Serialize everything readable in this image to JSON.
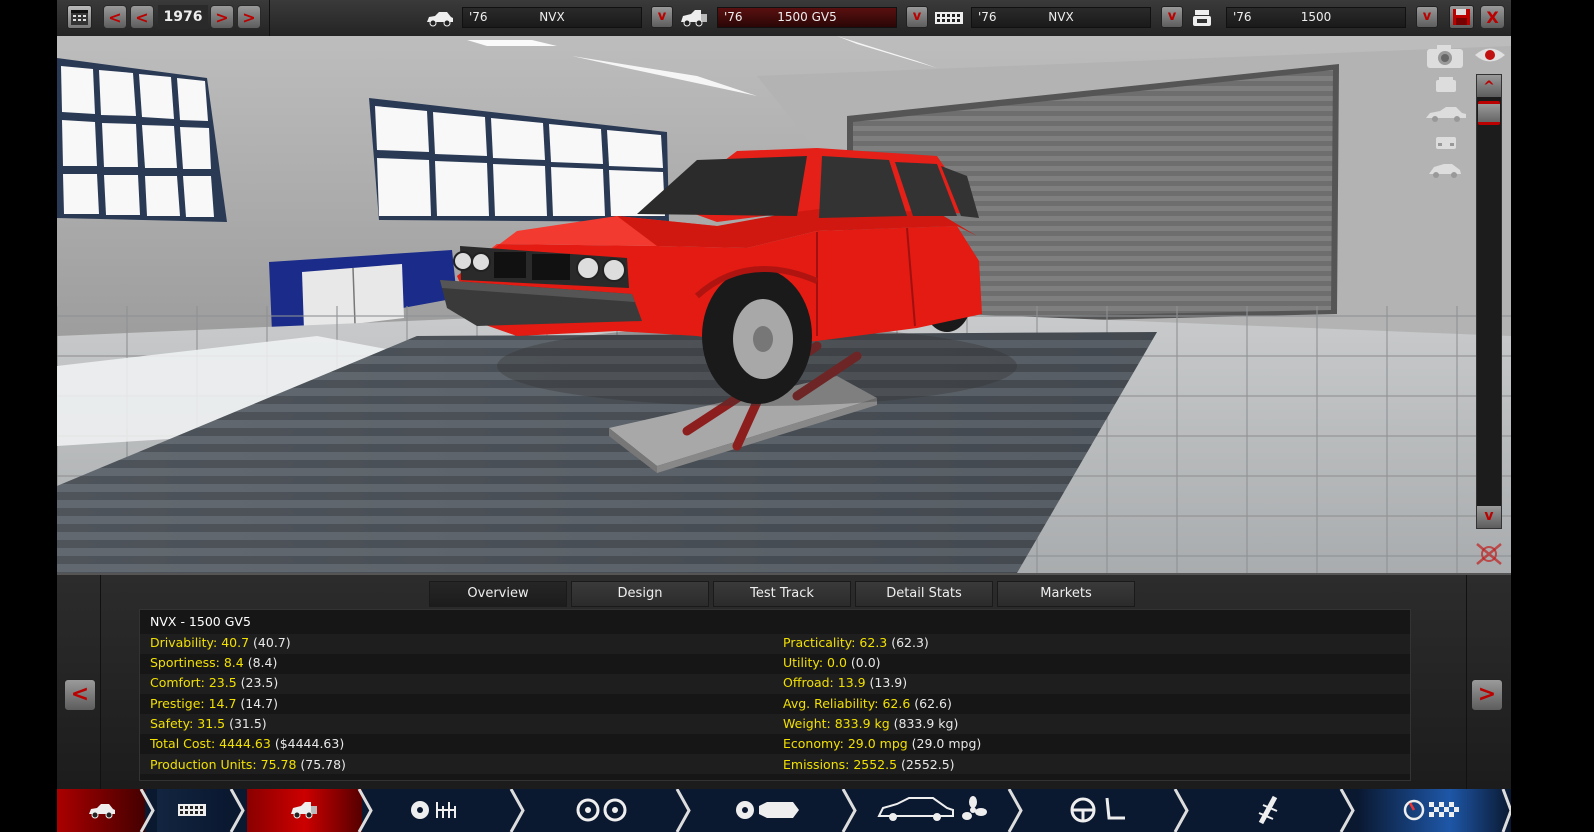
{
  "topbar": {
    "year": "1976",
    "prev_label": "<",
    "next_label": ">",
    "model": {
      "year": "'76",
      "name": "NVX"
    },
    "trim": {
      "year": "'76",
      "name": "1500 GV5"
    },
    "family": {
      "year": "'76",
      "name": "NVX"
    },
    "engine": {
      "year": "'76",
      "name": "1500"
    },
    "dropdown_label": "v",
    "close_label": "X"
  },
  "viewport": {
    "up_label": "^",
    "down_label": "v"
  },
  "tabs": [
    {
      "label": "Overview",
      "active": true
    },
    {
      "label": "Design",
      "active": false
    },
    {
      "label": "Test Track",
      "active": false
    },
    {
      "label": "Detail Stats",
      "active": false
    },
    {
      "label": "Markets",
      "active": false
    }
  ],
  "stats": {
    "title": "NVX - 1500 GV5",
    "left": [
      {
        "k": "Drivability: 40.7",
        "p": " (40.7)"
      },
      {
        "k": "Sportiness: 8.4",
        "p": " (8.4)"
      },
      {
        "k": "Comfort: 23.5",
        "p": " (23.5)"
      },
      {
        "k": "Prestige: 14.7",
        "p": " (14.7)"
      },
      {
        "k": "Safety: 31.5",
        "p": " (31.5)"
      },
      {
        "k": "Total Cost: 4444.63",
        "p": " ($4444.63)"
      },
      {
        "k": "Production Units: 75.78",
        "p": " (75.78)"
      }
    ],
    "right": [
      {
        "k": "Practicality: 62.3",
        "p": " (62.3)"
      },
      {
        "k": "Utility: 0.0",
        "p": " (0.0)"
      },
      {
        "k": "Offroad: 13.9",
        "p": " (13.9)"
      },
      {
        "k": "Avg. Reliability: 62.6",
        "p": " (62.6)"
      },
      {
        "k": "Weight: 833.9 kg",
        "p": " (833.9 kg)"
      },
      {
        "k": "Economy: 29.0 mpg",
        "p": " (29.0 mpg)"
      },
      {
        "k": "Emissions: 2552.5",
        "p": " (2552.5)"
      }
    ]
  },
  "nav": {
    "prev_label": "<",
    "next_label": ">",
    "sections": [
      {
        "icon": "car-icon",
        "active": true
      },
      {
        "icon": "chassis-icon",
        "active": false
      },
      {
        "icon": "body-icon",
        "active": true
      },
      {
        "icon": "suspension-icon",
        "active": false
      },
      {
        "icon": "wheels-icon",
        "active": false
      },
      {
        "icon": "brakes-icon",
        "active": false
      },
      {
        "icon": "aero-icon",
        "active": false
      },
      {
        "icon": "interior-icon",
        "active": false
      },
      {
        "icon": "fuel-system-icon",
        "active": false
      },
      {
        "icon": "testing-icon",
        "active": false
      }
    ]
  },
  "colors": {
    "car": "#e31b12",
    "stat_key": "#f2e000",
    "accent_red": "#b00000",
    "nav_blue": "#0a1830"
  }
}
